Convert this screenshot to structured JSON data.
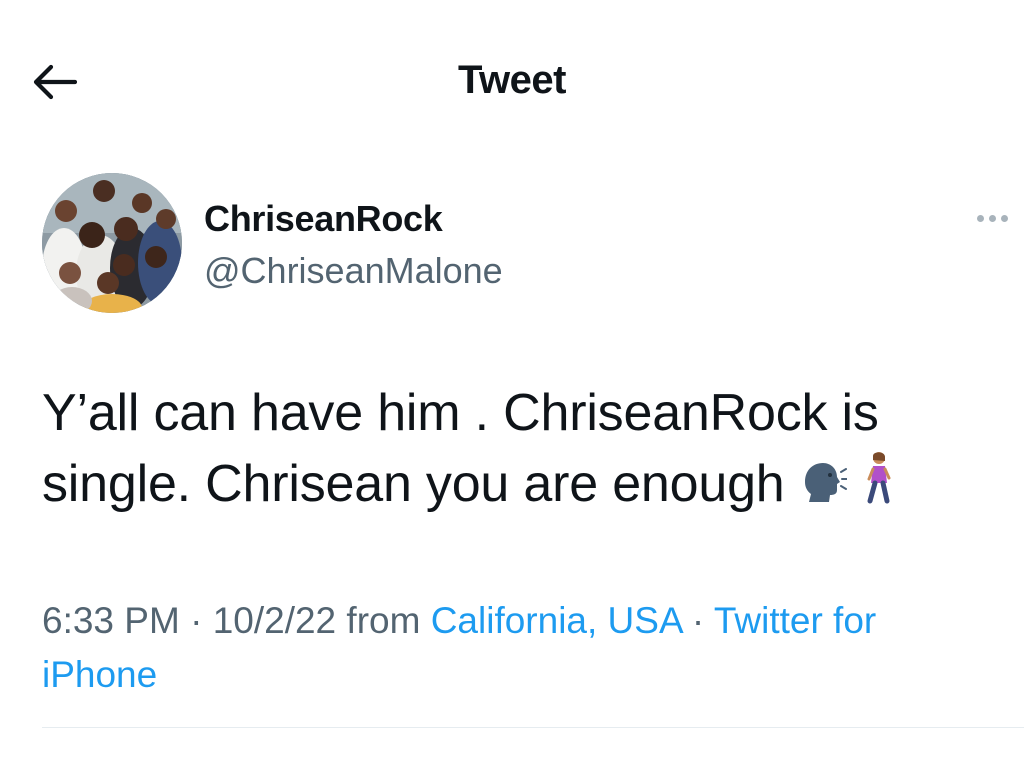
{
  "header": {
    "title": "Tweet",
    "back_icon": "arrow-left-icon"
  },
  "author": {
    "display_name": "ChriseanRock",
    "handle": "@ChriseanMalone",
    "more_icon": "more-horizontal-icon"
  },
  "tweet": {
    "line1": "Y’all can have him . ChriseanRock is",
    "line2": "single. Chrisean you are enough",
    "emojis": [
      "speaking-head-emoji",
      "woman-walking-emoji"
    ]
  },
  "meta": {
    "time": "6:33 PM",
    "sep1": " · ",
    "date": "10/2/22",
    "from_word": " from ",
    "location": "California, USA",
    "sep2": " · ",
    "source_line1": "Twitter for",
    "source_line2": "iPhone"
  },
  "colors": {
    "text": "#0f1419",
    "secondary": "#536471",
    "link": "#1d9bf0"
  }
}
